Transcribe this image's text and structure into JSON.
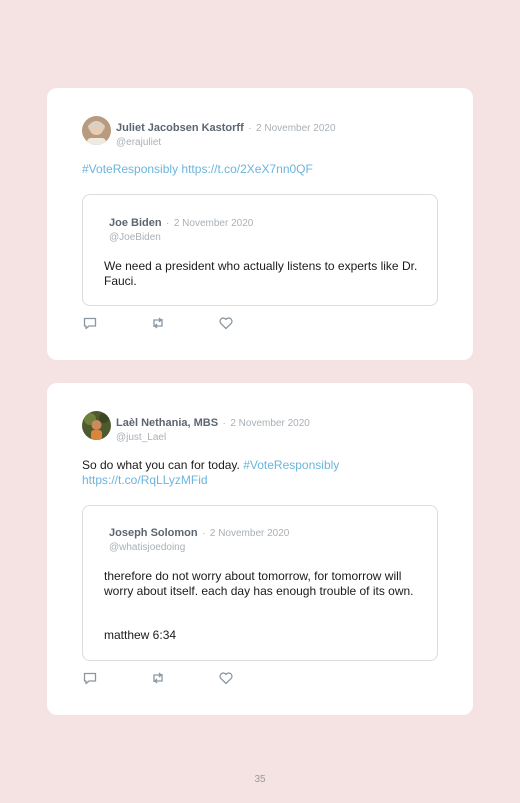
{
  "colors": {
    "background": "#f5e2e2",
    "card": "#ffffff",
    "link": "#6bb5dc",
    "meta": "#a8b0b6"
  },
  "posts": [
    {
      "author": "Juliet Jacobsen Kastorff",
      "separator": "·",
      "date": "2 November 2020",
      "handle": "@erajuliet",
      "text_plain": "",
      "hashtag": "#VoteResponsibly",
      "link": "https://t.co/2XeX7nn0QF",
      "quote": {
        "author": "Joe Biden",
        "separator": "·",
        "date": "2 November 2020",
        "handle": "@JoeBiden",
        "text": "We need a president who actually listens to experts like Dr. Fauci."
      },
      "actions": [
        "reply-icon",
        "retweet-icon",
        "like-icon"
      ]
    },
    {
      "author": "Laèl Nethania, MBS",
      "separator": "·",
      "date": "2 November 2020",
      "handle": "@just_Lael",
      "text_plain": "So do what you can for today. ",
      "hashtag": "#VoteResponsibly",
      "link": "https://t.co/RqLLyzMFid",
      "quote": {
        "author": "Joseph Solomon",
        "separator": "·",
        "date": "2 November 2020",
        "handle": "@whatisjoedoing",
        "text": "therefore do not worry about tomorrow, for tomorrow will worry about itself. each day has enough trouble of its own.",
        "text2": "matthew 6:34"
      },
      "actions": [
        "reply-icon",
        "retweet-icon",
        "like-icon"
      ]
    }
  ],
  "page_number": "35"
}
